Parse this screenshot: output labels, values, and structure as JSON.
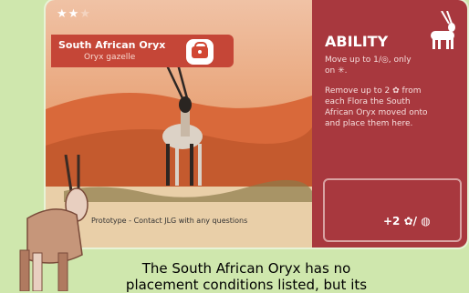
{
  "card": {
    "stars_filled": "★★",
    "stars_empty": "★",
    "name": "South African Oryx",
    "latin": "Oryx gazelle",
    "footer": "Prototype - Contact JLG with any questions",
    "bonus": "+2 ✿/ ◍"
  },
  "ability": {
    "title": "ABILITY",
    "line1": "Move up to 1/◎, only",
    "line2": "on ✳.",
    "line3": "Remove up to 2 ✿ from",
    "line4": "each Flora the South",
    "line5": "African Oryx moved onto",
    "line6": "and place them here."
  },
  "caption": {
    "line1": "The South African Oryx has no",
    "line2": "placement conditions listed, but its"
  },
  "colors": {
    "panel": "#a8383e",
    "banner": "#c54637",
    "background": "#cfe7ad"
  }
}
